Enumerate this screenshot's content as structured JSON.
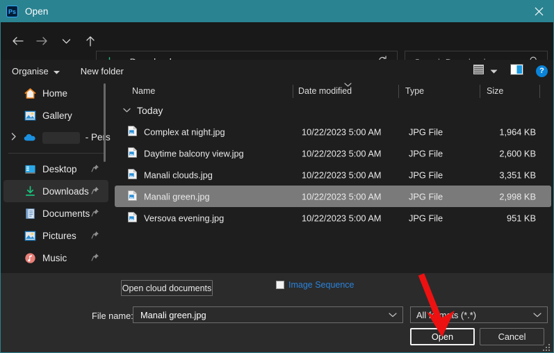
{
  "titlebar": {
    "app_icon": "photoshop-icon",
    "app_icon_text": "Ps",
    "title": "Open",
    "close_label": "✕"
  },
  "navbar": {
    "back_icon": "←",
    "forward_icon": "→",
    "recent_icon": "⌄",
    "up_icon": "↑",
    "address": {
      "location_icon": "downloads-icon",
      "separator": "›",
      "crumb": "Downloads",
      "dropdown_icon": "⌄",
      "refresh_icon": "↻"
    },
    "search": {
      "placeholder": "Search Downloads",
      "value": "",
      "icon": "search-icon"
    }
  },
  "commandbar": {
    "organise_label": "Organise",
    "organise_caret": "▾",
    "new_folder_label": "New folder",
    "view_icon": "list-view-icon",
    "view_caret": "▾",
    "preview_pane_icon": "preview-pane-icon",
    "help_label": "?"
  },
  "sidebar": {
    "items": [
      {
        "label": "Home",
        "icon": "home-icon",
        "pinned": false,
        "expandable": false,
        "selected": false
      },
      {
        "label": "Gallery",
        "icon": "gallery-icon",
        "pinned": false,
        "expandable": false,
        "selected": false
      },
      {
        "label": "- Pers",
        "icon": "onedrive-icon",
        "pinned": false,
        "expandable": true,
        "selected": false,
        "redacted": true
      },
      {
        "label": "Desktop",
        "icon": "desktop-icon",
        "pinned": true,
        "expandable": false,
        "selected": false
      },
      {
        "label": "Downloads",
        "icon": "downloads-icon",
        "pinned": true,
        "expandable": false,
        "selected": true
      },
      {
        "label": "Documents",
        "icon": "documents-icon",
        "pinned": true,
        "expandable": false,
        "selected": false
      },
      {
        "label": "Pictures",
        "icon": "pictures-icon",
        "pinned": true,
        "expandable": false,
        "selected": false
      },
      {
        "label": "Music",
        "icon": "music-icon",
        "pinned": true,
        "expandable": false,
        "selected": false
      }
    ],
    "pin_glyph": "📌"
  },
  "filelist": {
    "columns": [
      "Name",
      "Date modified",
      "Type",
      "Size"
    ],
    "sort_caret": "⌄",
    "group": {
      "caret": "⌄",
      "label": "Today"
    },
    "rows": [
      {
        "name": "Complex at night.jpg",
        "date": "10/22/2023 5:00 AM",
        "type": "JPG File",
        "size": "1,964 KB",
        "selected": false
      },
      {
        "name": "Daytime balcony view.jpg",
        "date": "10/22/2023 5:00 AM",
        "type": "JPG File",
        "size": "2,600 KB",
        "selected": false
      },
      {
        "name": "Manali clouds.jpg",
        "date": "10/22/2023 5:00 AM",
        "type": "JPG File",
        "size": "3,351 KB",
        "selected": false
      },
      {
        "name": "Manali green.jpg",
        "date": "10/22/2023 5:00 AM",
        "type": "JPG File",
        "size": "2,998 KB",
        "selected": true
      },
      {
        "name": "Versova evening.jpg",
        "date": "10/22/2023 5:00 AM",
        "type": "JPG File",
        "size": "951 KB",
        "selected": false
      }
    ]
  },
  "bottom": {
    "open_cloud_label": "Open cloud documents",
    "image_sequence_label": "Image Sequence",
    "image_sequence_checked": false,
    "filename_label": "File name:",
    "filename_value": "Manali green.jpg",
    "format_value": "All formats (*.*)",
    "combo_caret": "⌄",
    "open_label": "Open",
    "cancel_label": "Cancel"
  },
  "colors": {
    "titlebar": "#2a8391",
    "window_bg": "#1e1e1e",
    "bottom_panel": "#2b2b2b",
    "selection": "#7a7a7a",
    "accent_blue": "#2a82da",
    "annotation_red": "#ee1111"
  }
}
